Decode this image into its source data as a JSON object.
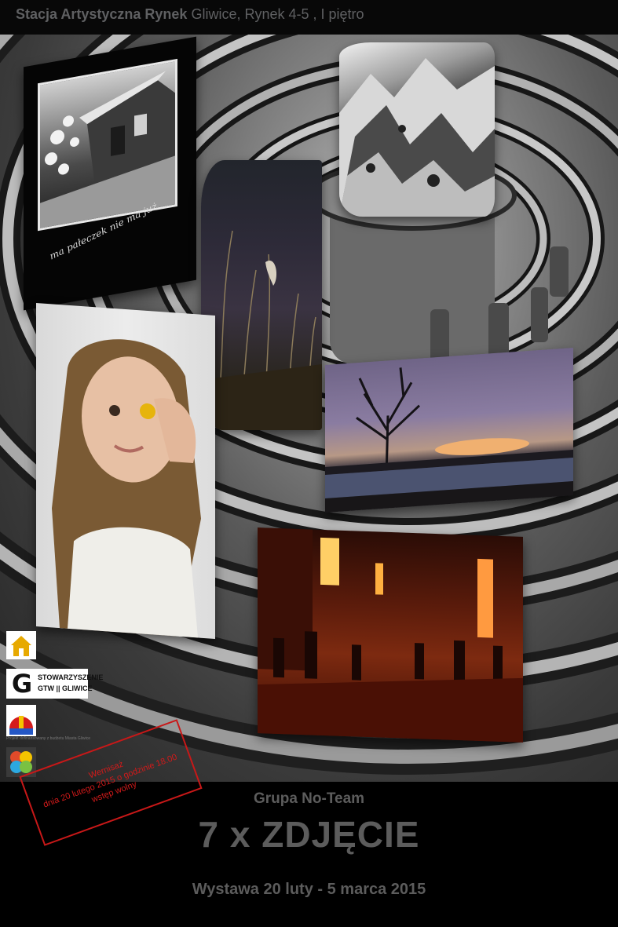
{
  "header": {
    "venue_bold": "Stacja Artystyczna Rynek",
    "venue_rest": "Gliwice, Rynek 4-5 , I piętro"
  },
  "photos": {
    "house_caption": "ma pałeczek nie ma już"
  },
  "logos": {
    "gtw_line1": "STOWARZYSZENIE",
    "gtw_line2": "GTW || GLIWICE",
    "gliwice_label": "GLIWICE",
    "project_note": "Projekt dofinansowany z budżetu Miasta Gliwice"
  },
  "stamp": {
    "line1": "Wernisaż",
    "line2": "dnia 20 lutego 2015 o godzinie 18.00",
    "line3": "wstęp wolny"
  },
  "footer": {
    "group": "Grupa No-Team",
    "title": "7 x ZDJĘCIE",
    "dates": "Wystawa 20 luty - 5 marca 2015"
  },
  "colors": {
    "background": "#000000",
    "text_gray": "#5c5c5c",
    "stamp_red": "#c81818"
  }
}
